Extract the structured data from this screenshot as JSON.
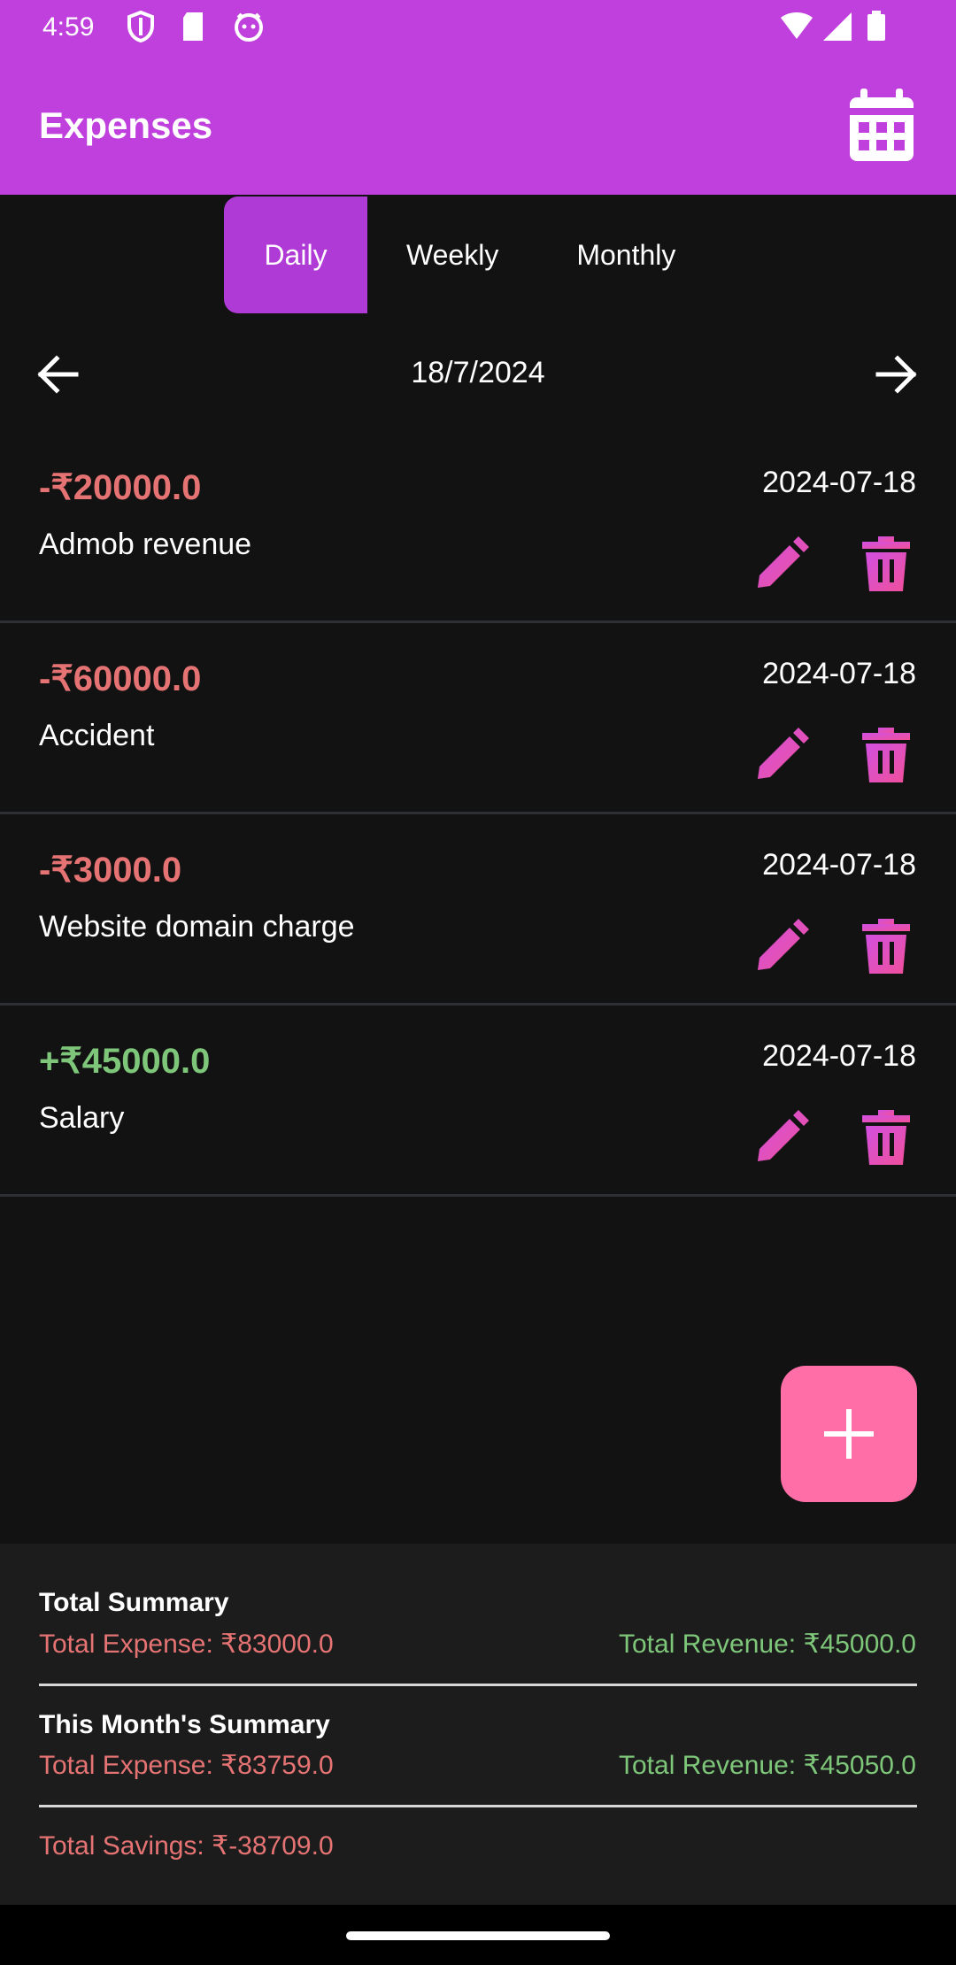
{
  "status_bar": {
    "time": "4:59"
  },
  "app_bar": {
    "title": "Expenses"
  },
  "tabs": [
    {
      "label": "Daily",
      "active": true
    },
    {
      "label": "Weekly",
      "active": false
    },
    {
      "label": "Monthly",
      "active": false
    }
  ],
  "date_nav": {
    "date": "18/7/2024"
  },
  "entries": [
    {
      "amount": "-₹20000.0",
      "description": "Admob revenue",
      "date": "2024-07-18",
      "type": "expense"
    },
    {
      "amount": "-₹60000.0",
      "description": "Accident",
      "date": "2024-07-18",
      "type": "expense"
    },
    {
      "amount": "-₹3000.0",
      "description": "Website domain charge",
      "date": "2024-07-18",
      "type": "expense"
    },
    {
      "amount": "+₹45000.0",
      "description": "Salary",
      "date": "2024-07-18",
      "type": "revenue"
    }
  ],
  "summary": {
    "total_title": "Total Summary",
    "total_expense": "Total Expense: ₹83000.0",
    "total_revenue": "Total Revenue: ₹45000.0",
    "month_title": "This Month's Summary",
    "month_expense": "Total Expense: ₹83759.0",
    "month_revenue": "Total Revenue: ₹45050.0",
    "total_savings": "Total Savings: ₹-38709.0"
  },
  "colors": {
    "app_bar": "#bf40dd",
    "active_tab": "#b03ad6",
    "expense": "#e57373",
    "revenue": "#7ec77a",
    "fab": "#ff6ea6",
    "action_icon": "#e052c8"
  },
  "icons": {
    "calendar": "calendar-icon",
    "prev": "arrow-left-icon",
    "next": "arrow-right-icon",
    "edit": "pencil-icon",
    "delete": "trash-icon",
    "add": "plus-icon"
  }
}
